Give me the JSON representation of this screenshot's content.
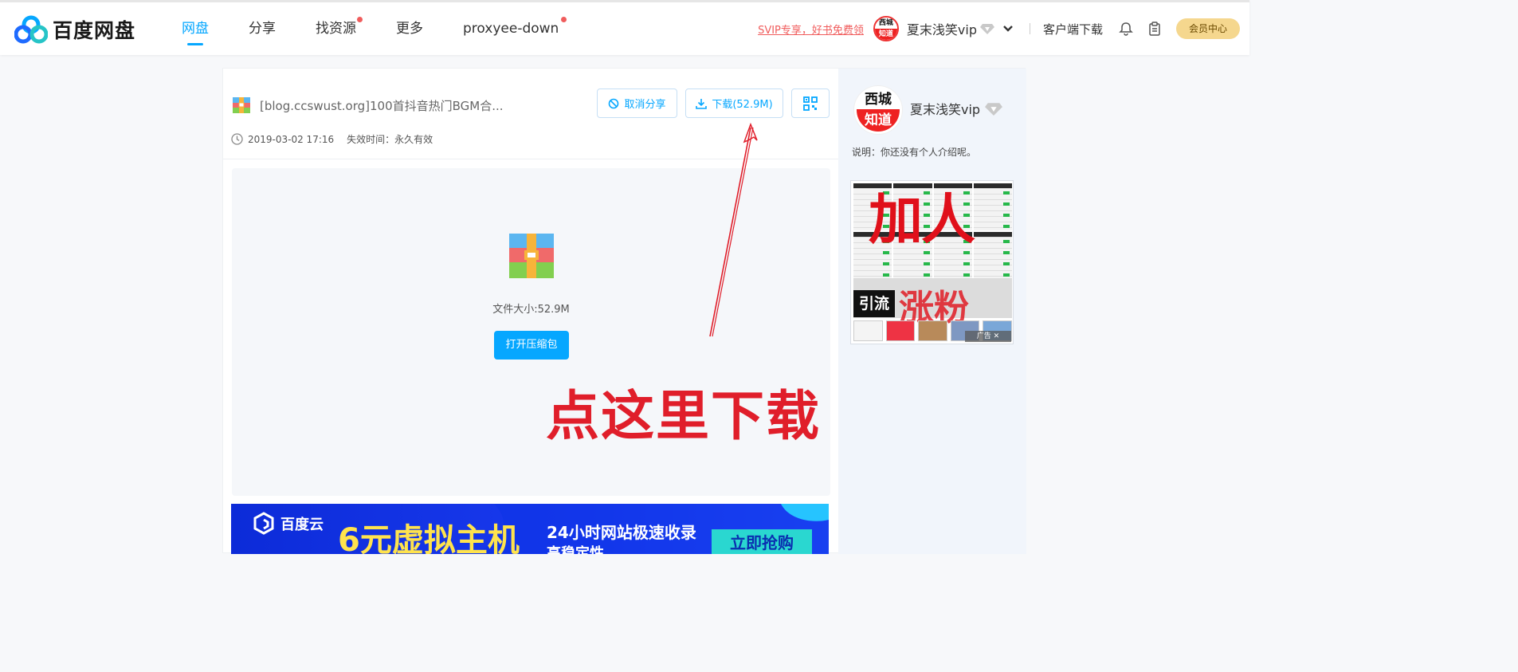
{
  "app": {
    "logo_text": "百度网盘",
    "accent_color": "#06a7ff"
  },
  "nav": {
    "items": [
      {
        "label": "网盘",
        "active": true,
        "dot": false
      },
      {
        "label": "分享",
        "active": false,
        "dot": false
      },
      {
        "label": "找资源",
        "active": false,
        "dot": true
      },
      {
        "label": "更多",
        "active": false,
        "dot": false
      },
      {
        "label": "proxyee-down",
        "active": false,
        "dot": true
      }
    ]
  },
  "header": {
    "svip_promo": "SVIP专享，好书免费领",
    "avatar_top": "西城",
    "avatar_bottom": "知道",
    "username": "夏末浅笑vip",
    "client_download": "客户端下载",
    "vip_center": "会员中心",
    "icons": [
      "diamond-icon",
      "chevron-down-icon",
      "bell-icon",
      "clipboard-icon"
    ]
  },
  "share": {
    "file_title": "[blog.ccswust.org]100首抖音热门BGM合...",
    "date": "2019-03-02 17:16",
    "expire_label": "失效时间：永久有效",
    "cancel_share_label": "取消分享",
    "download_label": "下载(52.9M)",
    "qr_icon": "qrcode-icon"
  },
  "preview": {
    "file_size": "文件大小:52.9M",
    "open_archive_label": "打开压缩包"
  },
  "annotation": {
    "text": "点这里下载",
    "color": "#e01e2a"
  },
  "banner_ad": {
    "brand": "百度云",
    "headline": "6元虚拟主机",
    "line1": "24小时网站极速收录",
    "line2": "高稳定性",
    "cta": "立即抢购"
  },
  "sidebar": {
    "avatar_top": "西城",
    "avatar_bottom": "知道",
    "username": "夏末浅笑vip",
    "description": "说明：你还没有个人介绍呢。",
    "ad": {
      "headline": "加人",
      "tag": "引流",
      "fragment": "涨粉",
      "close_label": "广告 ✕"
    }
  }
}
